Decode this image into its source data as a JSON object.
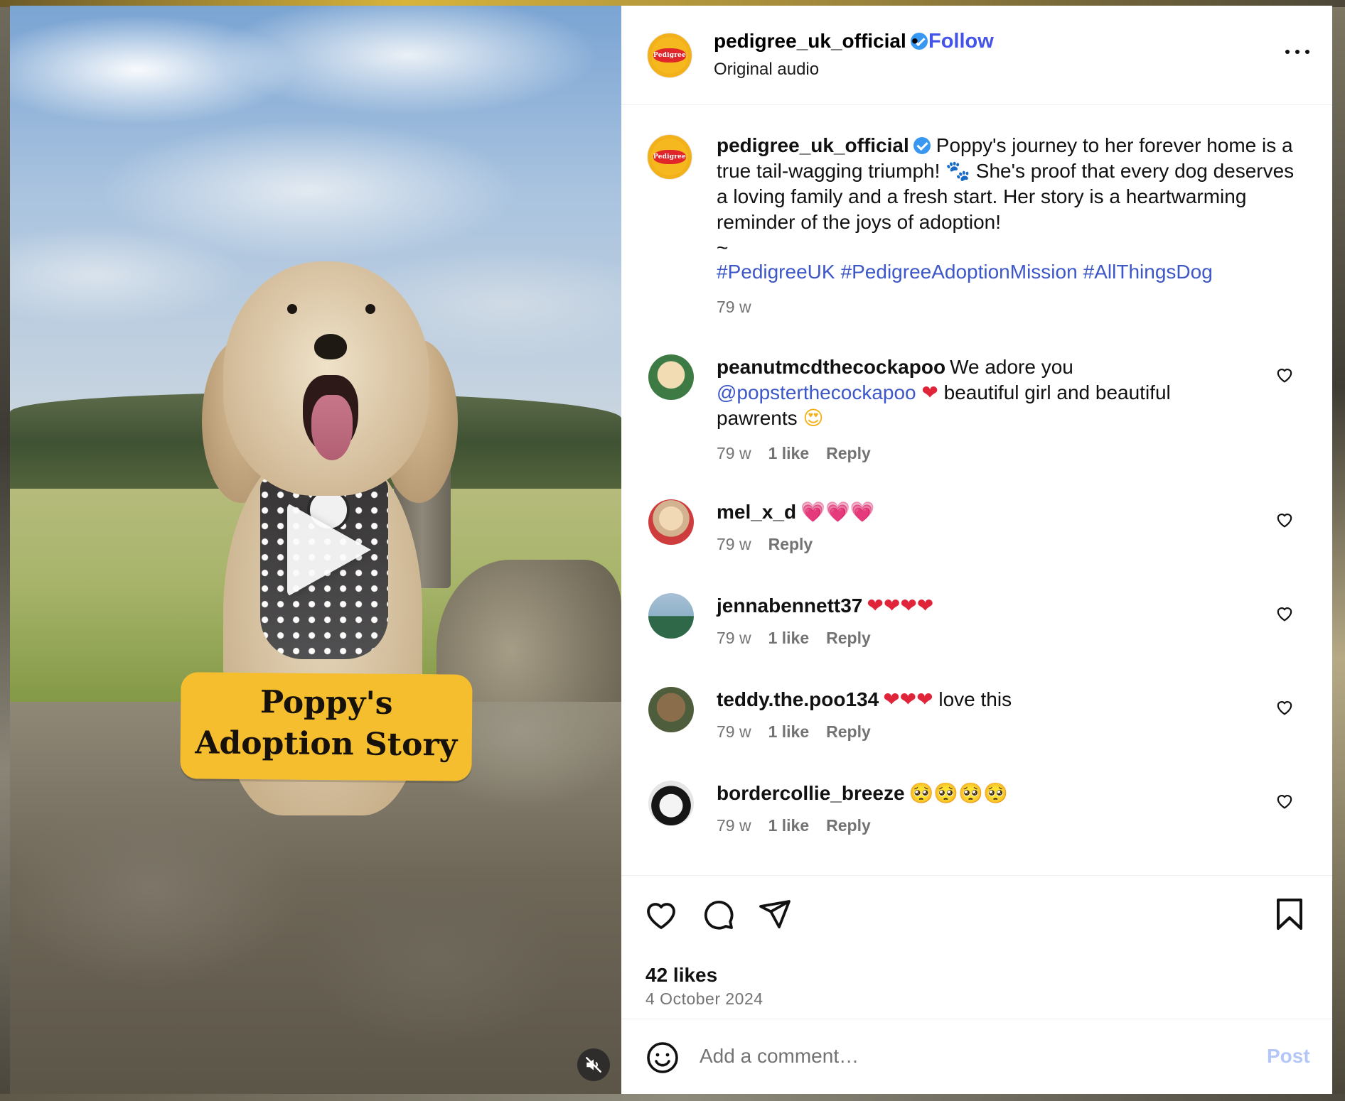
{
  "header": {
    "username": "pedigree_uk_official",
    "follow_label": "Follow",
    "separator": "•",
    "subtitle": "Original audio",
    "avatar_logo_text": "Pedigree"
  },
  "video": {
    "sticker_line1": "Poppy's",
    "sticker_line2": "Adoption Story",
    "play_icon": "play-icon",
    "mute_icon": "muted-speaker-icon"
  },
  "caption": {
    "username": "pedigree_uk_official",
    "text": "Poppy's journey to her forever home is a true tail-wagging triumph! 🐾 She's proof that every dog deserves a loving family and a fresh start. Her story is a heartwarming reminder of the joys of adoption!",
    "tilde": "~",
    "hashtags": [
      "#PedigreeUK",
      "#PedigreeAdoptionMission",
      "#AllThingsDog"
    ],
    "time": "79 w"
  },
  "comments": [
    {
      "username": "peanutmcdthecockapoo",
      "text_before": "We adore you",
      "mention": "@popsterthecockapoo",
      "emoji": "❤",
      "text_after": "beautiful girl and beautiful pawrents",
      "emoji_end": "😍",
      "time": "79 w",
      "likes": "1 like",
      "reply": "Reply"
    },
    {
      "username": "mel_x_d",
      "emoji": "💗💗💗",
      "time": "79 w",
      "reply": "Reply"
    },
    {
      "username": "jennabennett37",
      "emoji": "❤❤❤❤",
      "time": "79 w",
      "likes": "1 like",
      "reply": "Reply"
    },
    {
      "username": "teddy.the.poo134",
      "emoji": "❤❤❤",
      "text_after": "love this",
      "time": "79 w",
      "likes": "1 like",
      "reply": "Reply"
    },
    {
      "username": "bordercollie_breeze",
      "emoji": "🥺🥺🥺🥺",
      "time": "79 w",
      "likes": "1 like",
      "reply": "Reply"
    }
  ],
  "actions": {
    "likes": "42 likes",
    "date": "4 October 2024"
  },
  "comment_box": {
    "placeholder": "Add a comment…",
    "post_label": "Post"
  },
  "colors": {
    "link_blue": "#4454e8",
    "hashtag_blue": "#3d57c9",
    "verified_blue": "#3897f0",
    "muted_grey": "#737373",
    "post_button_disabled": "#b3c6f7",
    "sticker_yellow": "#f5be2f"
  }
}
